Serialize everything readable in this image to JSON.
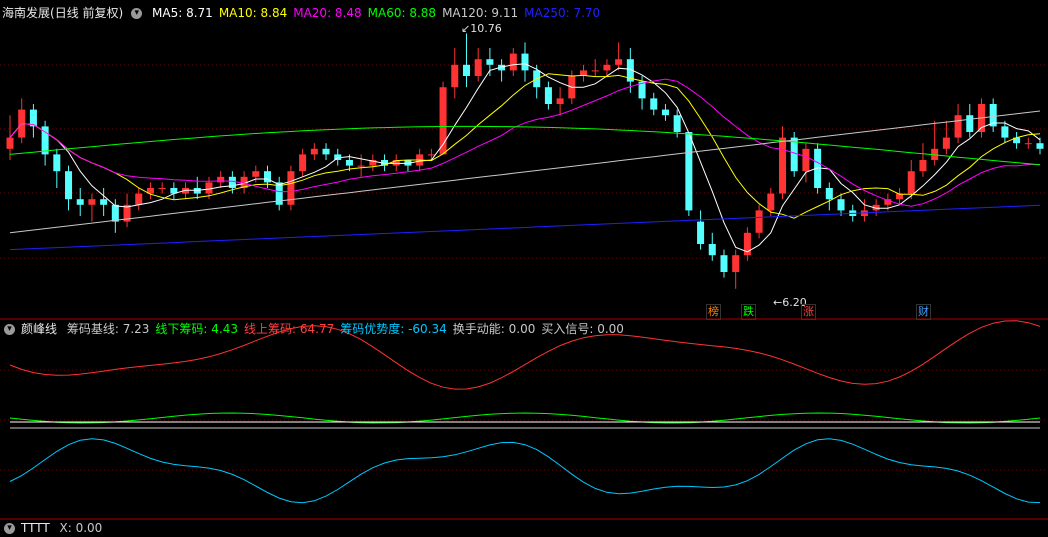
{
  "main": {
    "stock_name": "海南发展",
    "period": "(日线 前复权)",
    "ma": [
      {
        "label": "MA5:",
        "value": "8.71",
        "color": "#ffffff"
      },
      {
        "label": "MA10:",
        "value": "8.84",
        "color": "#ffff00"
      },
      {
        "label": "MA20:",
        "value": "8.48",
        "color": "#ff00ff"
      },
      {
        "label": "MA60:",
        "value": "8.88",
        "color": "#00ff00"
      },
      {
        "label": "MA120:",
        "value": "9.11",
        "color": "#c8c8c8"
      },
      {
        "label": "MA250:",
        "value": "7.70",
        "color": "#2020ff"
      }
    ],
    "high_label": "10.76",
    "low_label": "6.20",
    "badges": [
      {
        "text": "榜",
        "color": "#ff8000"
      },
      {
        "text": "跌",
        "color": "#00ff00"
      },
      {
        "text": "涨",
        "color": "#ff4040"
      },
      {
        "text": "财",
        "color": "#40a0ff"
      }
    ]
  },
  "indicator": {
    "name": "颜峰线",
    "items": [
      {
        "label": "筹码基线:",
        "value": "7.23",
        "color": "#c8c8c8"
      },
      {
        "label": "线下筹码:",
        "value": "4.43",
        "color": "#00ff00"
      },
      {
        "label": "线上筹码:",
        "value": "64.77",
        "color": "#ff4040"
      },
      {
        "label": "筹码优势度:",
        "value": "-60.34",
        "color": "#00c8ff"
      },
      {
        "label": "换手动能:",
        "value": "0.00",
        "color": "#c8c8c8"
      },
      {
        "label": "买入信号:",
        "value": "0.00",
        "color": "#c8c8c8"
      }
    ]
  },
  "bottom": {
    "label": "TTTT",
    "item": "X: 0.00"
  },
  "colors": {
    "up": "#ff3333",
    "down": "#54ffff",
    "grid": "#7a0000",
    "border": "#aa0000"
  }
}
